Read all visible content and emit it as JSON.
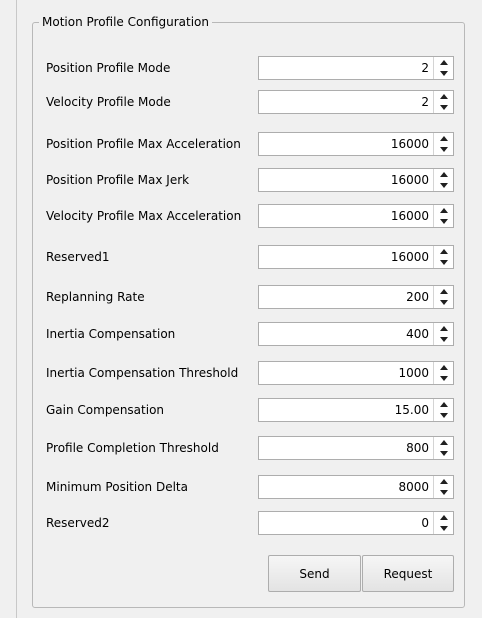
{
  "group_title": "Motion Profile Configuration",
  "rows": [
    {
      "label": "Position Profile Mode",
      "value": "2"
    },
    {
      "label": "Velocity Profile Mode",
      "value": "2"
    },
    {
      "label": "Position Profile Max Acceleration",
      "value": "16000"
    },
    {
      "label": "Position Profile Max Jerk",
      "value": "16000"
    },
    {
      "label": "Velocity Profile Max Acceleration",
      "value": "16000"
    },
    {
      "label": "Reserved1",
      "value": "16000"
    },
    {
      "label": "Replanning Rate",
      "value": "200"
    },
    {
      "label": "Inertia Compensation",
      "value": "400"
    },
    {
      "label": "Inertia Compensation Threshold",
      "value": "1000"
    },
    {
      "label": "Gain Compensation",
      "value": "15.00"
    },
    {
      "label": "Profile Completion Threshold",
      "value": "800"
    },
    {
      "label": "Minimum Position Delta",
      "value": "8000"
    },
    {
      "label": "Reserved2",
      "value": "0"
    }
  ],
  "buttons": {
    "send_label": "Send",
    "request_label": "Request"
  }
}
